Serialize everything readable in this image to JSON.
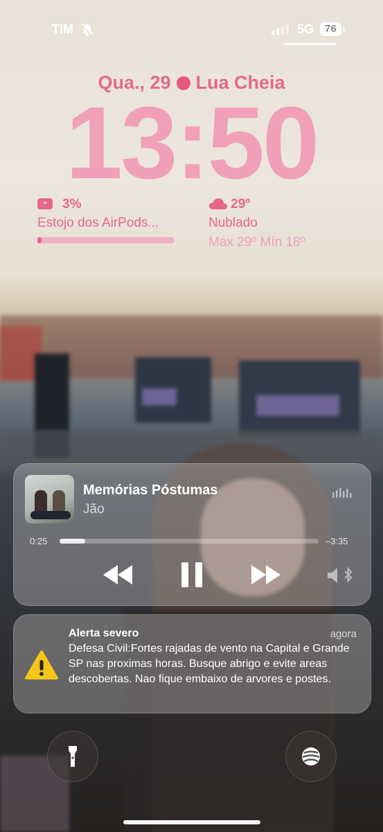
{
  "status_bar": {
    "carrier": "TIM",
    "network": "5G",
    "battery_level": "76"
  },
  "lock_screen": {
    "date": "Qua., 29",
    "moon_phase": "Lua Cheia",
    "time": "13:50"
  },
  "widgets": {
    "airpods": {
      "percent": "3%",
      "name": "Estojo dos AirPods...",
      "level_fraction": 0.03
    },
    "weather": {
      "temperature": "29º",
      "condition": "Nublado",
      "range": "Máx 29º Mín 18º"
    }
  },
  "now_playing": {
    "title": "Memórias Póstumas",
    "artist": "Jão",
    "elapsed": "0:25",
    "remaining": "–3:35",
    "progress_fraction": 0.1
  },
  "notification": {
    "title": "Alerta severo",
    "time": "agora",
    "body": "Defesa Civil:Fortes rajadas de vento na Capital e Grande SP nas proximas horas. Busque abrigo e evite areas descobertas. Nao fique embaixo de arvores e postes."
  },
  "icons": {
    "bell_muted": "bell-slash-icon",
    "signal": "cellular-signal-icon",
    "airpods_case": "airpods-case-icon",
    "weather": "cloud-icon",
    "equalizer": "audio-bars-icon",
    "rewind": "rewind-icon",
    "pause": "pause-icon",
    "fast_forward": "fast-forward-icon",
    "audio_output": "speaker-bluetooth-icon",
    "alert": "warning-triangle-icon",
    "flashlight": "flashlight-icon",
    "camera": "camera-icon"
  },
  "colors": {
    "accent_pink": "#e5688a",
    "clock_pink": "#f0a0b8",
    "warning_yellow": "#f5c518"
  }
}
